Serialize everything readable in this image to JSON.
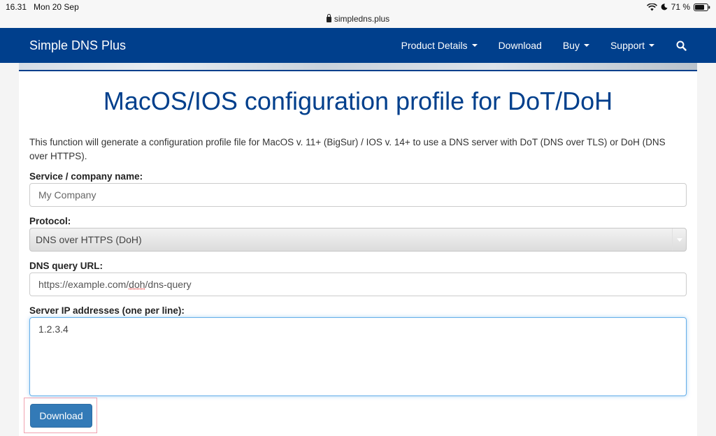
{
  "status_bar": {
    "time": "16.31",
    "date": "Mon 20 Sep",
    "url": "simpledns.plus",
    "battery": "71 %"
  },
  "navbar": {
    "brand": "Simple DNS Plus",
    "items": [
      {
        "label": "Product Details",
        "has_dropdown": true
      },
      {
        "label": "Download",
        "has_dropdown": false
      },
      {
        "label": "Buy",
        "has_dropdown": true
      },
      {
        "label": "Support",
        "has_dropdown": true
      }
    ],
    "search_icon": "search-icon",
    "color": "#003f8c"
  },
  "page": {
    "title": "MacOS/IOS configuration profile for DoT/DoH",
    "intro": "This function will generate a configuration profile file for MacOS v. 11+ (BigSur) / IOS v. 14+ to use a DNS server with DoT (DNS over TLS) or DoH (DNS over HTTPS).",
    "form": {
      "service_label": "Service / company name:",
      "service_placeholder": "My Company",
      "protocol_label": "Protocol:",
      "protocol_value": "DNS over HTTPS (DoH)",
      "url_label": "DNS query URL:",
      "url_value_prefix": "https://example.com/",
      "url_value_mid": "doh",
      "url_value_suffix": "/dns-query",
      "ips_label": "Server IP addresses (one per line):",
      "ips_value": "1.2.3.4",
      "download_button": "Download"
    }
  }
}
